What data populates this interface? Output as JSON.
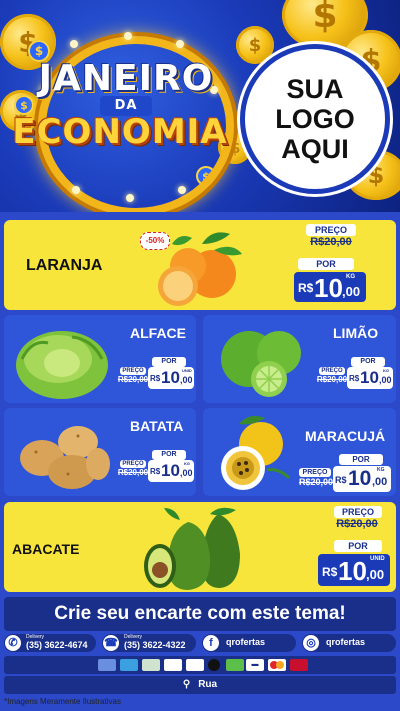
{
  "header": {
    "title_line1": "JANEIRO",
    "title_line2": "DA",
    "title_line3": "ECONOMIA",
    "logo_line1": "SUA",
    "logo_line2": "LOGO",
    "logo_line3": "AQUI"
  },
  "products": {
    "laranja": {
      "name": "LARANJA",
      "badge": "-50%",
      "preco_label": "PREÇO",
      "old_price": "R$20,00",
      "por_label": "POR",
      "currency": "R$",
      "price_int": "10",
      "price_dec": ",00",
      "unit": "KG"
    },
    "alface": {
      "name": "ALFACE",
      "preco_label": "PREÇO",
      "old_price": "R$20,00",
      "por_label": "POR",
      "currency": "R$",
      "price_int": "10",
      "price_dec": ",00",
      "unit": "UNID"
    },
    "limao": {
      "name": "LIMÃO",
      "preco_label": "PREÇO",
      "old_price": "R$20,00",
      "por_label": "POR",
      "currency": "R$",
      "price_int": "10",
      "price_dec": ",00",
      "unit": "KG"
    },
    "batata": {
      "name": "BATATA",
      "preco_label": "PREÇO",
      "old_price": "R$20,00",
      "por_label": "POR",
      "currency": "R$",
      "price_int": "10",
      "price_dec": ",00",
      "unit": "KG"
    },
    "maracuja": {
      "name": "MARACUJÁ",
      "preco_label": "PREÇO",
      "old_price": "R$20,00",
      "por_label": "POR",
      "currency": "R$",
      "price_int": "10",
      "price_dec": ",00",
      "unit": "KG"
    },
    "abacate": {
      "name": "ABACATE",
      "preco_label": "PREÇO",
      "old_price": "R$20,00",
      "por_label": "POR",
      "currency": "R$",
      "price_int": "10",
      "price_dec": ",00",
      "unit": "UNID"
    }
  },
  "footer": {
    "cta": "Crie seu encarte com este tema!",
    "whatsapp_label": "Delivery",
    "whatsapp_phone": "(35) 3622-4674",
    "phone_label": "Delivery",
    "phone_number": "(35) 3622-4322",
    "facebook": "qrofertas",
    "instagram": "qrofertas",
    "address": "Rua",
    "disclaimer": "*Imagens Meramente Ilustrativas"
  },
  "colors": {
    "brand_blue": "#1a3ab8",
    "brand_yellow": "#f7e53b",
    "card_blue": "#2f55d8"
  }
}
